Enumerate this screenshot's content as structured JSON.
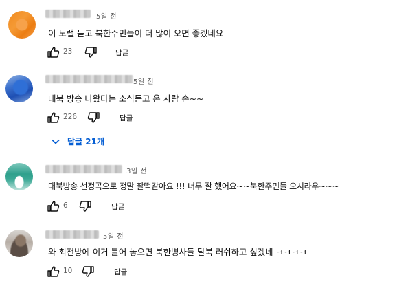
{
  "comments": [
    {
      "time": "5일 전",
      "text": "이 노랠 듣고 북한주민들이 더 많이 오면 좋겠네요",
      "likes": "23",
      "reply_label": "답글",
      "avatar_icon": "orange-avatar"
    },
    {
      "time": "5일 전",
      "text": "대북 방송 나왔다는 소식듣고 온 사람 손~~",
      "likes": "226",
      "reply_label": "답글",
      "avatar_icon": "blue-avatar"
    },
    {
      "time": "3일 전",
      "text": "대북방송 선정곡으로 정말 찰떡같아요 !!!  너무 잘 했어요~~북한주민들 오시라우~~~",
      "likes": "6",
      "reply_label": "답글",
      "avatar_icon": "teal-avatar"
    },
    {
      "time": "5일 전",
      "text": "와 최전방에 이거 틀어 놓으면 북한병사들 탈북 러쉬하고 싶겠네 ㅋㅋㅋㅋ",
      "likes": "10",
      "reply_label": "답글",
      "avatar_icon": "photo-avatar"
    }
  ],
  "replies_toggle": {
    "label": "답글 21개"
  },
  "colors": {
    "link": "#065fd4",
    "meta": "#606060",
    "text": "#0f0f0f"
  }
}
